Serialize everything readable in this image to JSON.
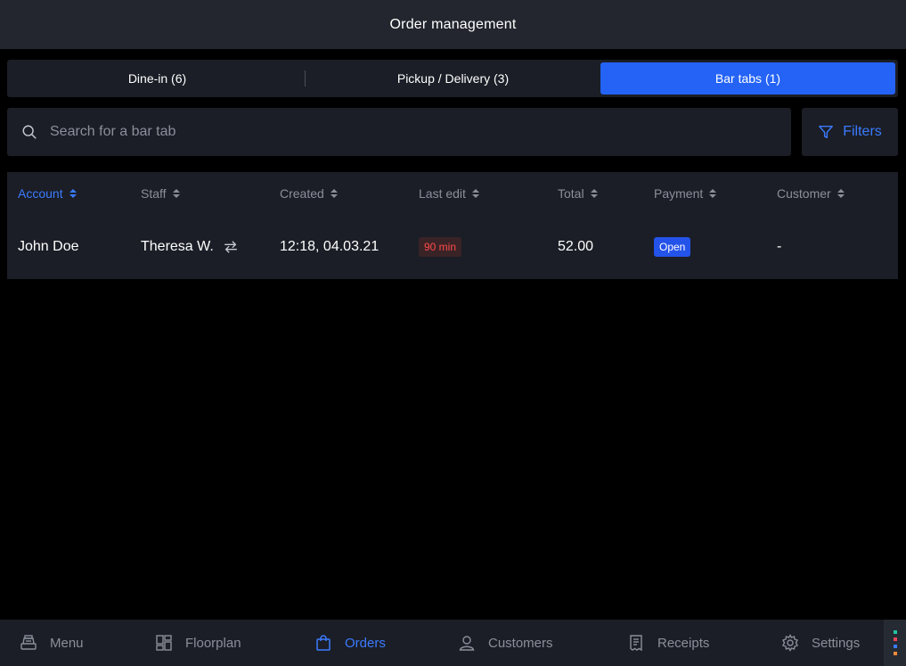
{
  "header": {
    "title": "Order management"
  },
  "segments": [
    {
      "label": "Dine-in (6)",
      "active": false
    },
    {
      "label": "Pickup / Delivery (3)",
      "active": false
    },
    {
      "label": "Bar tabs (1)",
      "active": true
    }
  ],
  "search": {
    "placeholder": "Search for a bar tab",
    "value": ""
  },
  "filters": {
    "label": "Filters"
  },
  "table": {
    "columns": [
      "Account",
      "Staff",
      "Created",
      "Last edit",
      "Total",
      "Payment",
      "Customer"
    ],
    "sorted_column": "Account",
    "rows": [
      {
        "account": "John Doe",
        "staff": "Theresa W.",
        "created": "12:18, 04.03.21",
        "last_edit": "90 min",
        "total": "52.00",
        "payment": "Open",
        "customer": "-"
      }
    ]
  },
  "nav": {
    "items": [
      {
        "label": "Menu",
        "icon": "cash-register-icon"
      },
      {
        "label": "Floorplan",
        "icon": "floorplan-icon"
      },
      {
        "label": "Orders",
        "icon": "shopping-bag-icon"
      },
      {
        "label": "Customers",
        "icon": "user-icon"
      },
      {
        "label": "Receipts",
        "icon": "receipt-icon"
      },
      {
        "label": "Settings",
        "icon": "gear-icon"
      }
    ],
    "active": "Orders"
  },
  "colors": {
    "accent": "#2463f5",
    "link": "#3b7bff",
    "warning": "#ff4a4a",
    "background": "#000000",
    "panel": "#1b1e26"
  }
}
